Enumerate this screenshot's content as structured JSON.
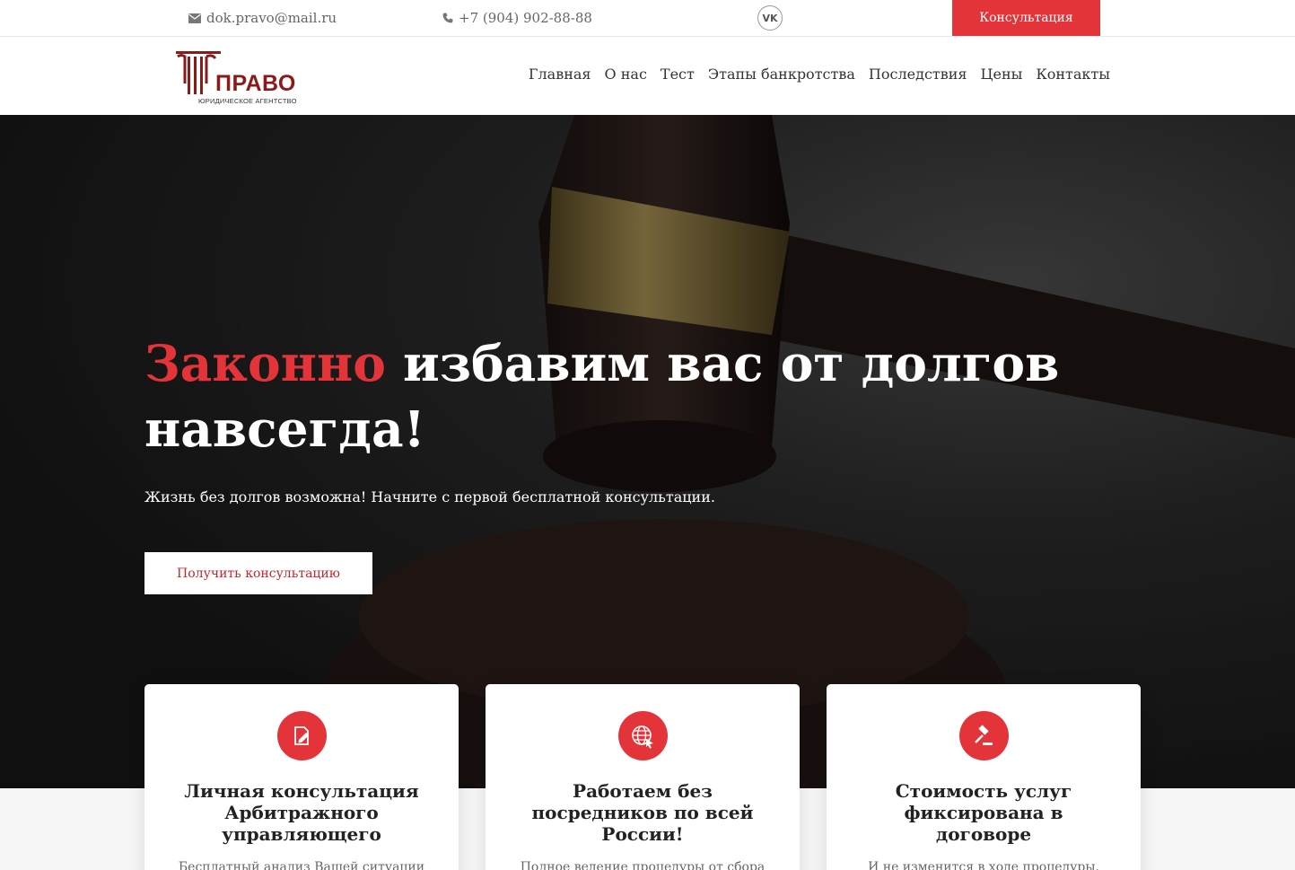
{
  "topbar": {
    "email": "dok.pravo@mail.ru",
    "phone": "+7 (904) 902-88-88",
    "social": "VK",
    "consult_button": "Консультация"
  },
  "logo": {
    "word": "ПРАВО",
    "subtitle": "ЮРИДИЧЕСКОЕ АГЕНТСТВО"
  },
  "nav": {
    "items": [
      {
        "label": "Главная"
      },
      {
        "label": "О нас"
      },
      {
        "label": "Тест"
      },
      {
        "label": "Этапы банкротства"
      },
      {
        "label": "Последствия"
      },
      {
        "label": "Цены"
      },
      {
        "label": "Контакты"
      }
    ]
  },
  "hero": {
    "title_accent": "Законно",
    "title_rest": " избавим вас от долгов навсегда!",
    "subtitle": "Жизнь без долгов возможна! Начните с первой бесплатной консультации.",
    "cta": "Получить консультацию"
  },
  "cards": [
    {
      "icon": "document-pen-icon",
      "title": "Личная консультация Арбитражного управляющего",
      "text": "Бесплатный анализ Вашей ситуации"
    },
    {
      "icon": "globe-cursor-icon",
      "title": "Работаем без посредников по всей России!",
      "text": "Полное ведение процедуры от сбора"
    },
    {
      "icon": "gavel-icon",
      "title": "Стоимость услуг фиксирована в договоре",
      "text": "И не изменится в ходе процедуры."
    }
  ],
  "colors": {
    "accent": "#e3343a",
    "logo": "#8b1a1a"
  }
}
